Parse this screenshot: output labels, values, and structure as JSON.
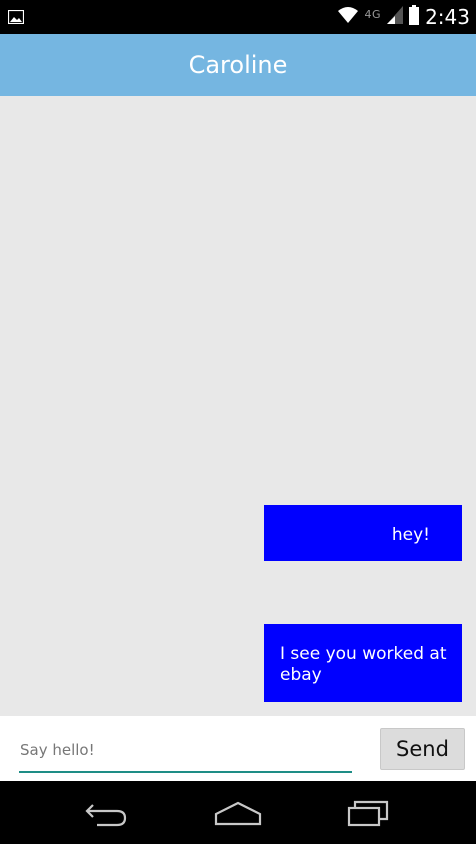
{
  "status_bar": {
    "time": "2:43",
    "network": "4G",
    "icons": [
      "image-icon",
      "wifi-icon",
      "signal-icon",
      "battery-icon"
    ]
  },
  "app_bar": {
    "title": "Caroline",
    "color": "#75b6e1"
  },
  "messages": [
    {
      "text": "hey!",
      "bubble_color": "#0000ff"
    },
    {
      "text": "I see you worked at ebay",
      "bubble_color": "#0000ff"
    }
  ],
  "composer": {
    "placeholder": "Say hello!",
    "value": "",
    "send_label": "Send",
    "underline_color": "#1e8d86"
  },
  "nav_bar": {
    "icons": [
      "back-icon",
      "home-icon",
      "recent-apps-icon"
    ]
  }
}
